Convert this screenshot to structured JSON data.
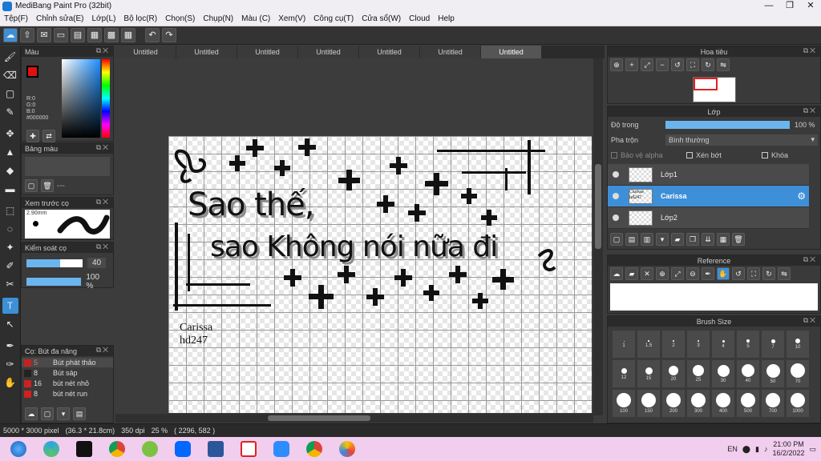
{
  "window": {
    "title": "MediBang Paint Pro (32bit)",
    "minimize": "—",
    "maximize": "❐",
    "close": "✕"
  },
  "menu": [
    "Tệp(F)",
    "Chỉnh sửa(E)",
    "Lớp(L)",
    "Bộ lọc(R)",
    "Chọn(S)",
    "Chụp(N)",
    "Màu (C)",
    "Xem(V)",
    "Công cụ(T)",
    "Cửa sổ(W)",
    "Cloud",
    "Help"
  ],
  "canvas_tabs": [
    "Untitled",
    "Untitled",
    "Untitled",
    "Untitled",
    "Untitled",
    "Untitled",
    "Untitled"
  ],
  "active_tab_index": 6,
  "left": {
    "color_panel_title": "Màu",
    "color_readout": {
      "r": "R:0",
      "g": "G:0",
      "b": "B:0",
      "hex": "#000000"
    },
    "palette_title": "Bảng màu",
    "palette_extra": "---",
    "brush_preview_title": "Xem trước cọ",
    "brush_size_preview": "2.90mm",
    "brush_control_title": "Kiểm soát cọ",
    "brush_size_value": "40",
    "brush_size_level": 0.6,
    "opacity_value": "100 %",
    "opacity_level": 1.0,
    "brush_list_title": "Cọ: Bút đa năng",
    "brushes": [
      {
        "size": "5",
        "name": "Bút phát thảo",
        "color": "#c62020"
      },
      {
        "size": "8",
        "name": "Bút sáp",
        "color": "#222222"
      },
      {
        "size": "16",
        "name": "bút nét nhỏ",
        "color": "#d02020"
      },
      {
        "size": "8",
        "name": "bút nét run",
        "color": "#d02020"
      }
    ]
  },
  "artwork": {
    "line1": "Sao thế,",
    "line2": "sao Không nói nữa đi",
    "signature_line1": "Carissa",
    "signature_line2": "hd247"
  },
  "status": {
    "pixels": "5000 * 3000 pixel",
    "cm": "(36.3 * 21.8cm)",
    "dpi": "350 dpi",
    "zoom": "25 %",
    "coords": "( 2296, 582 )"
  },
  "navigator": {
    "title": "Hoa tiêu"
  },
  "layers": {
    "title": "Lớp",
    "opacity_label": "Độ trong",
    "opacity_value": "100 %",
    "opacity_level": 1.0,
    "blend_label": "Pha trộn",
    "blend_value": "Bình thường",
    "protect_alpha": "Bảo vệ alpha",
    "clipping": "Xén bớt",
    "lock": "Khóa",
    "items": [
      {
        "name": "Lớp1",
        "selected": false
      },
      {
        "name": "Carissa",
        "selected": true,
        "thumb": "Carissa hd247"
      },
      {
        "name": "Lớp2",
        "selected": false
      }
    ]
  },
  "reference": {
    "title": "Reference"
  },
  "brush_size_panel": {
    "title": "Brush Size",
    "sizes": [
      "1",
      "1.5",
      "2",
      "3",
      "4",
      "5",
      "7",
      "10",
      "12",
      "15",
      "20",
      "25",
      "30",
      "40",
      "50",
      "70",
      "100",
      "150",
      "200",
      "300",
      "400",
      "500",
      "700",
      "1000"
    ]
  },
  "taskbar": {
    "apps": [
      "start",
      "edge-like",
      "capcut",
      "chrome",
      "zalo-green",
      "zalo",
      "word",
      "medibang",
      "zoom",
      "chrome-alt",
      "paint"
    ],
    "lang": "EN",
    "time": "21:00 PM",
    "date": "16/2/2022"
  },
  "colors": {
    "accent": "#3d8fd8",
    "panel": "#3a3a3a",
    "taskbar": "#f1cdee"
  }
}
